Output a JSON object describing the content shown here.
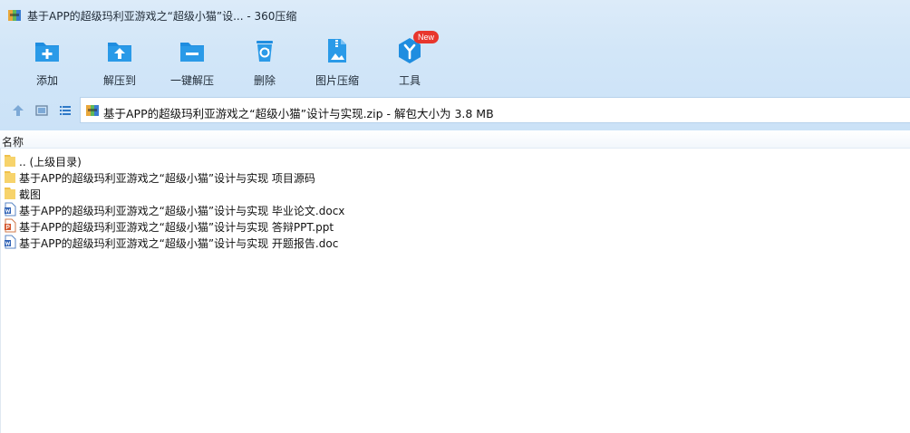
{
  "window": {
    "title": "基于APP的超级玛利亚游戏之“超级小猫”设... - 360压缩"
  },
  "toolbar": {
    "buttons": [
      {
        "label": "添加",
        "icon": "add-folder-icon"
      },
      {
        "label": "解压到",
        "icon": "extract-to-icon"
      },
      {
        "label": "一键解压",
        "icon": "one-click-extract-icon"
      },
      {
        "label": "删除",
        "icon": "recycle-bin-icon"
      },
      {
        "label": "图片压缩",
        "icon": "image-compress-icon"
      },
      {
        "label": "工具",
        "icon": "tools-icon",
        "badge": "New"
      }
    ]
  },
  "nav": {
    "path": "基于APP的超级玛利亚游戏之“超级小猫”设计与实现.zip - 解包大小为 3.8 MB"
  },
  "list": {
    "column_name": "名称",
    "items": [
      {
        "name": ".. (上级目录)",
        "type": "folder"
      },
      {
        "name": "基于APP的超级玛利亚游戏之“超级小猫”设计与实现 项目源码",
        "type": "folder"
      },
      {
        "name": "截图",
        "type": "folder"
      },
      {
        "name": "基于APP的超级玛利亚游戏之“超级小猫”设计与实现 毕业论文.docx",
        "type": "word"
      },
      {
        "name": "基于APP的超级玛利亚游戏之“超级小猫”设计与实现 答辩PPT.ppt",
        "type": "ppt"
      },
      {
        "name": "基于APP的超级玛利亚游戏之“超级小猫”设计与实现 开题报告.doc",
        "type": "word"
      }
    ]
  },
  "colors": {
    "accent": "#1f8de0",
    "folder": "#f7d36b",
    "badge": "#e8362d"
  }
}
